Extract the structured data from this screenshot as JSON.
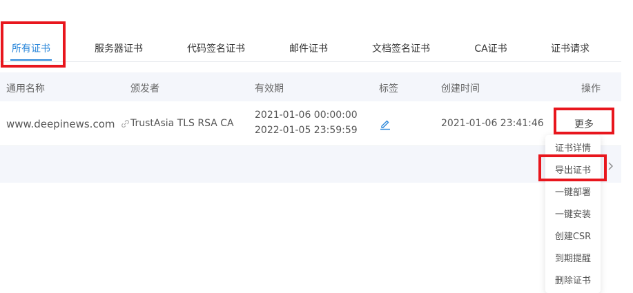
{
  "tabs": [
    {
      "label": "所有证书",
      "active": true
    },
    {
      "label": "服务器证书"
    },
    {
      "label": "代码签名证书"
    },
    {
      "label": "邮件证书"
    },
    {
      "label": "文档签名证书"
    },
    {
      "label": "CA证书"
    },
    {
      "label": "证书请求"
    }
  ],
  "table": {
    "headers": [
      "通用名称",
      "颁发者",
      "有效期",
      "标签",
      "创建时间",
      "操作"
    ],
    "rows": [
      {
        "common_name": "www.deepinews.com",
        "issuer": "TrustAsia TLS RSA CA",
        "valid_from": "2021-01-06 00:00:00",
        "valid_to": "2022-01-05 23:59:59",
        "created": "2021-01-06 23:41:46",
        "action_label": "更多"
      }
    ]
  },
  "dropdown": {
    "items": [
      "证书详情",
      "导出证书",
      "一键部署",
      "一键安装",
      "创建CSR",
      "到期提醒",
      "删除证书"
    ]
  },
  "colors": {
    "accent": "#2b87da",
    "highlight_box": "#e8161d",
    "header_bg": "#f4f6fb"
  }
}
